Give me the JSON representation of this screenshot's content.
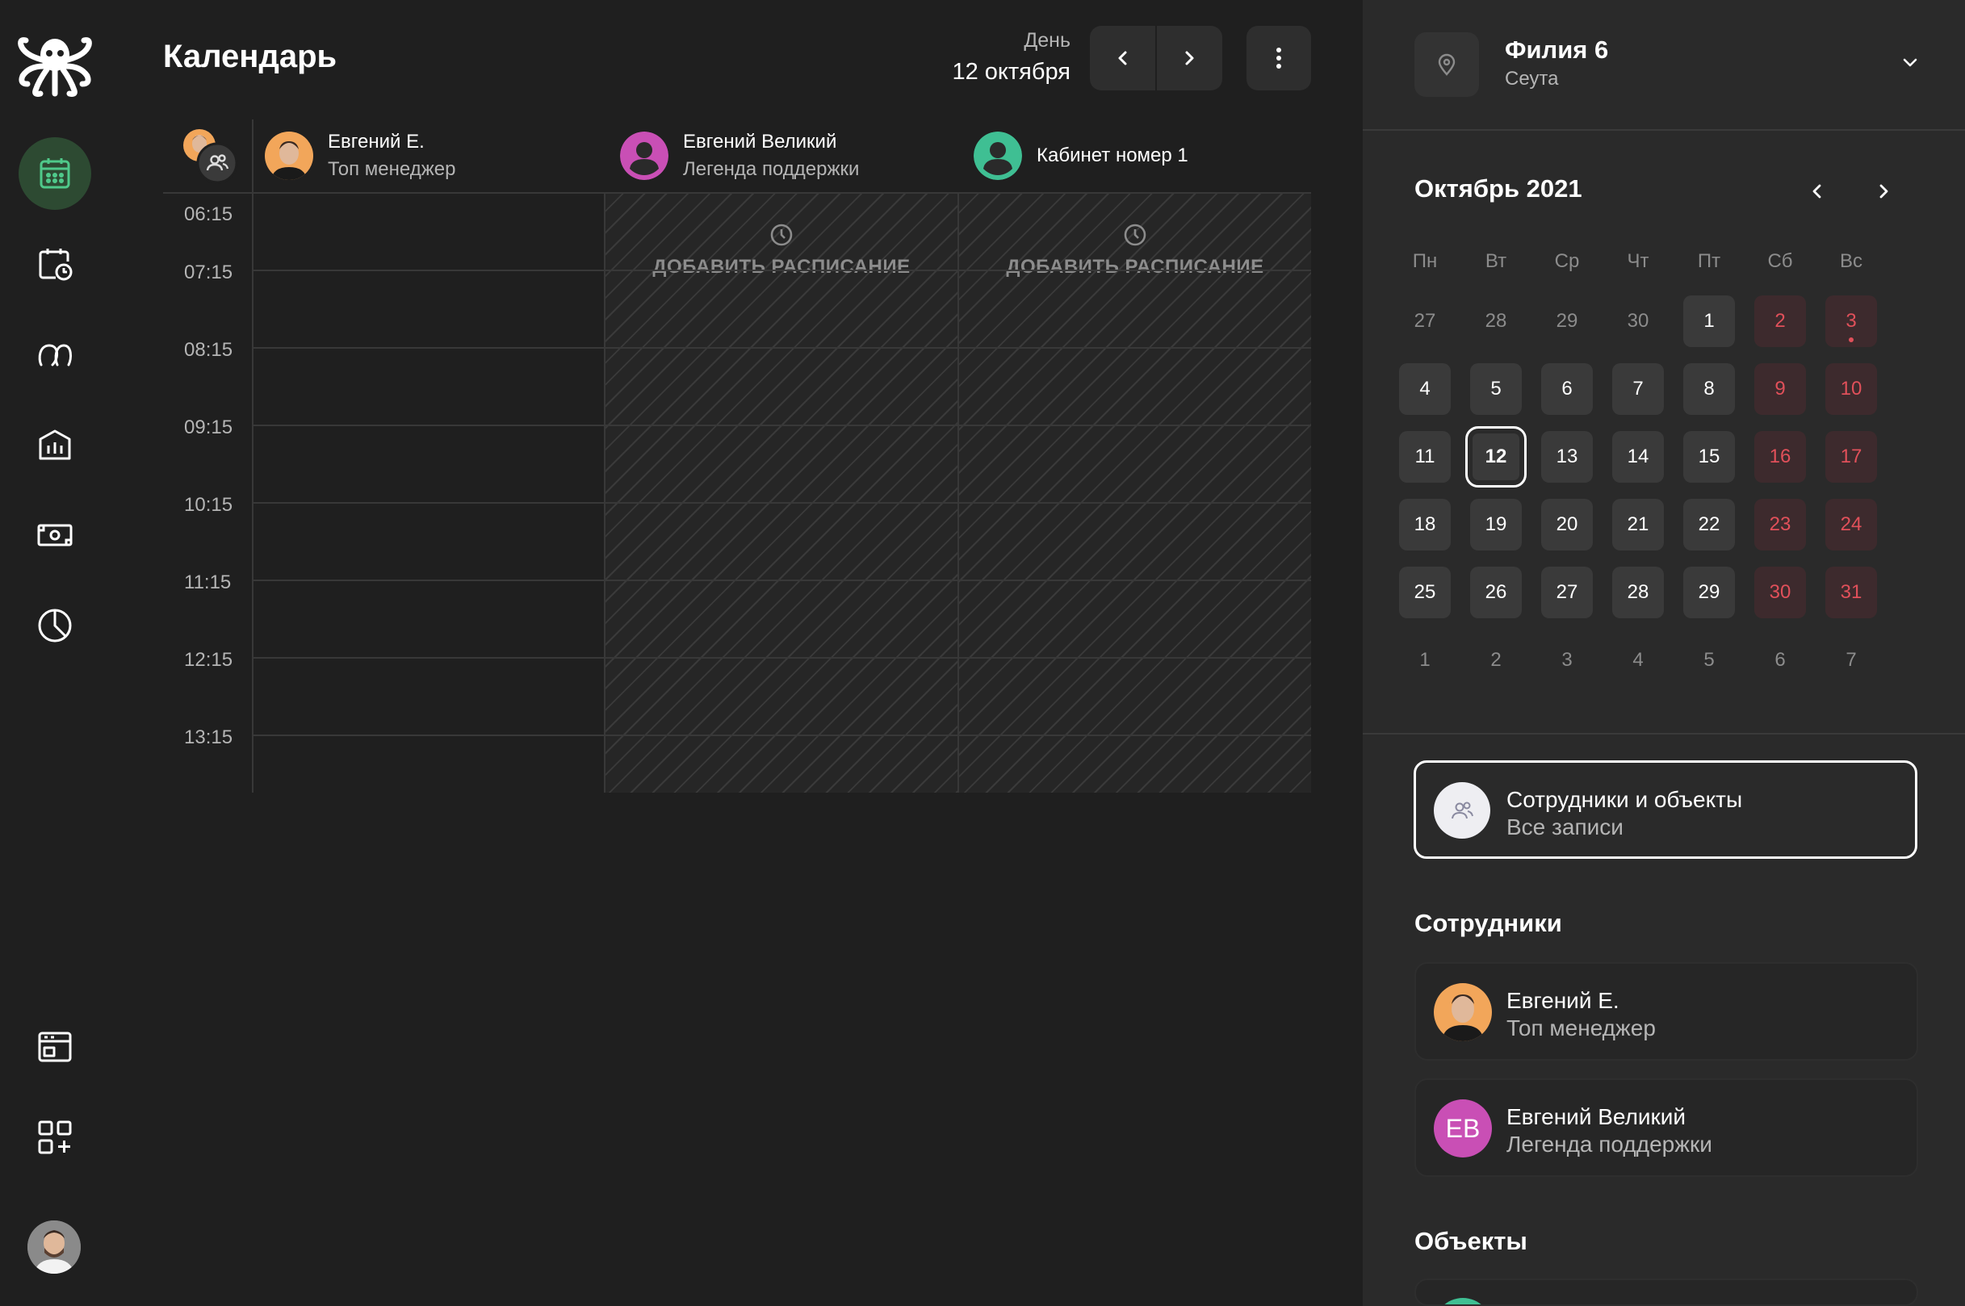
{
  "header": {
    "title": "Календарь",
    "view_label": "День",
    "date_label": "12 октября"
  },
  "columns": [
    {
      "name": "Евгений Е.",
      "role": "Топ менеджер"
    },
    {
      "name": "Евгений Великий",
      "role": "Легенда поддержки"
    },
    {
      "name": "Кабинет номер 1",
      "role": ""
    }
  ],
  "add_schedule_label": "ДОБАВИТЬ РАСПИСАНИЕ",
  "times": [
    "06:15",
    "07:15",
    "08:15",
    "09:15",
    "10:15",
    "11:15",
    "12:15",
    "13:15"
  ],
  "branch": {
    "name": "Филия 6",
    "city": "Сеута"
  },
  "mini_calendar": {
    "month_label": "Октябрь 2021",
    "weekdays": [
      "Пн",
      "Вт",
      "Ср",
      "Чт",
      "Пт",
      "Сб",
      "Вс"
    ],
    "weeks": [
      [
        "27",
        "28",
        "29",
        "30",
        "1",
        "2",
        "3"
      ],
      [
        "4",
        "5",
        "6",
        "7",
        "8",
        "9",
        "10"
      ],
      [
        "11",
        "12",
        "13",
        "14",
        "15",
        "16",
        "17"
      ],
      [
        "18",
        "19",
        "20",
        "21",
        "22",
        "23",
        "24"
      ],
      [
        "25",
        "26",
        "27",
        "28",
        "29",
        "30",
        "31"
      ],
      [
        "1",
        "2",
        "3",
        "4",
        "5",
        "6",
        "7"
      ]
    ],
    "selected_day": "12"
  },
  "all_filter": {
    "title": "Сотрудники и объекты",
    "subtitle": "Все записи"
  },
  "employees_title": "Сотрудники",
  "employees": [
    {
      "name": "Евгений Е.",
      "role": "Топ менеджер"
    },
    {
      "name": "Евгений Великий",
      "role": "Легенда поддержки",
      "initials": "ЕВ"
    }
  ],
  "objects_title": "Объекты",
  "colors": {
    "accent": "#4fc98a",
    "weekend": "#e0505a",
    "pink": "#c94fb5",
    "teal": "#3fbf93"
  }
}
